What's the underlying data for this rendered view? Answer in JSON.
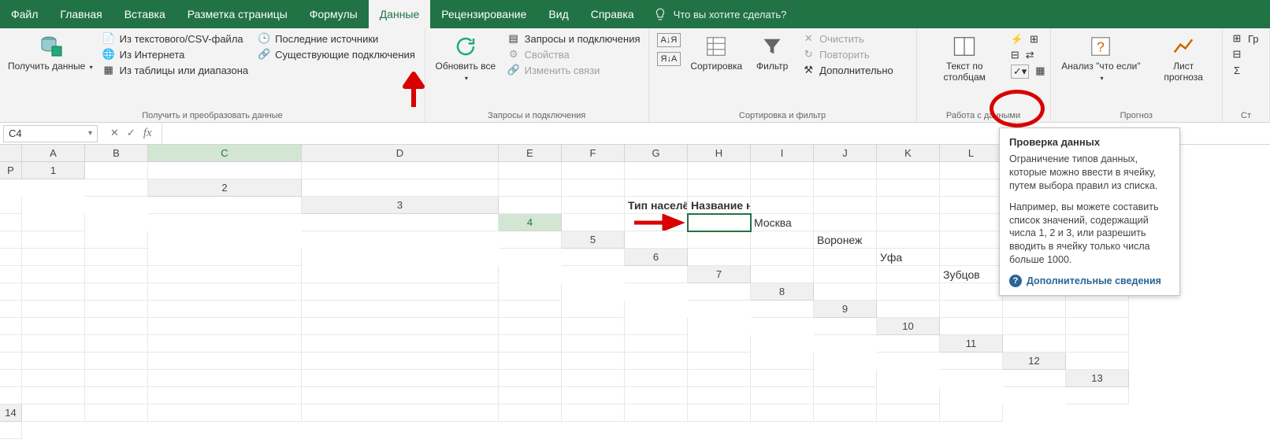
{
  "tabs": {
    "file": "Файл",
    "home": "Главная",
    "insert": "Вставка",
    "pagelayout": "Разметка страницы",
    "formulas": "Формулы",
    "data": "Данные",
    "review": "Рецензирование",
    "view": "Вид",
    "help": "Справка",
    "tellme": "Что вы хотите сделать?"
  },
  "ribbon": {
    "get_data": "Получить данные",
    "from_csv": "Из текстового/CSV-файла",
    "from_web": "Из Интернета",
    "from_table": "Из таблицы или диапазона",
    "recent_sources": "Последние источники",
    "existing_conn": "Существующие подключения",
    "group_get": "Получить и преобразовать данные",
    "refresh_all": "Обновить все",
    "queries": "Запросы и подключения",
    "properties": "Свойства",
    "edit_links": "Изменить связи",
    "group_queries": "Запросы и подключения",
    "sort": "Сортировка",
    "filter": "Фильтр",
    "clear": "Очистить",
    "reapply": "Повторить",
    "advanced": "Дополнительно",
    "group_sort": "Сортировка и фильтр",
    "text_to_cols": "Текст по столбцам",
    "group_tools": "Работа с данными",
    "whatif": "Анализ \"что если\"",
    "forecast": "Лист прогноза",
    "group_forecast": "Прогноз",
    "group_btn": "Гр",
    "group_label2": "Ст"
  },
  "namebox": "C4",
  "columns": [
    "A",
    "B",
    "C",
    "D",
    "E",
    "F",
    "G",
    "H",
    "I",
    "J",
    "K",
    "L",
    "P"
  ],
  "rows": [
    "1",
    "2",
    "3",
    "4",
    "5",
    "6",
    "7",
    "8",
    "9",
    "10",
    "11",
    "12",
    "13",
    "14"
  ],
  "cells": {
    "c3": "Тип населённого пункта",
    "d3": "Название населённого пункта",
    "d4": "Москва",
    "d5": "Воронеж",
    "d6": "Уфа",
    "d7": "Зубцов"
  },
  "tooltip": {
    "title": "Проверка данных",
    "p1": "Ограничение типов данных, которые можно ввести в ячейку, путем выбора правил из списка.",
    "p2": "Например, вы можете составить список значений, содержащий числа 1, 2 и 3, или разрешить вводить в ячейку только числа больше 1000.",
    "more": "Дополнительные сведения"
  }
}
